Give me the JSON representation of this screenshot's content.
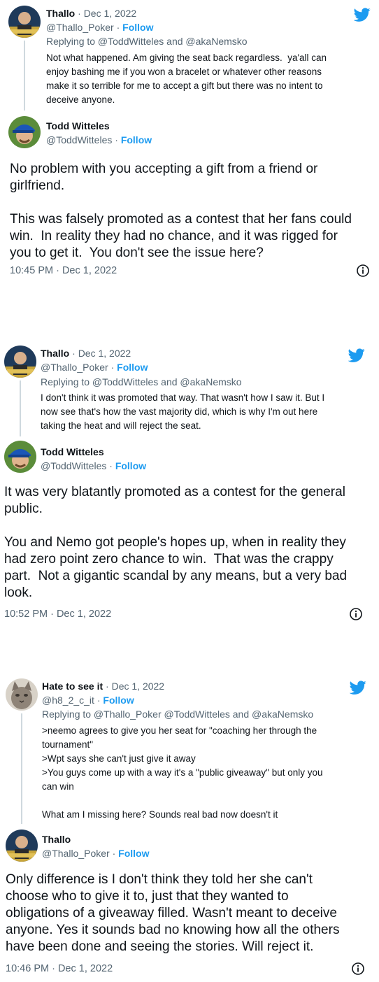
{
  "colors": {
    "accent": "#1d9bf0",
    "secondary_text": "#536471",
    "text": "#0f1419",
    "line": "#cfd9de"
  },
  "icons": {
    "logo": "twitter-bird-icon",
    "info": "info-icon"
  },
  "tweets": [
    {
      "parent": {
        "name": "Thallo",
        "separator": "·",
        "date": "Dec 1, 2022",
        "handle": "@Thallo_Poker",
        "follow": "Follow",
        "replying": "Replying to @ToddWitteles and @akaNemsko",
        "text": "Not what happened. Am giving the seat back regardless.  ya'all can\nenjoy bashing me if you won a bracelet or whatever other reasons\nmake it so terrible for me to accept a gift but there was no intent to\ndeceive anyone."
      },
      "reply": {
        "name": "Todd Witteles",
        "handle": "@ToddWitteles",
        "follow": "Follow",
        "text": "No problem with you accepting a gift from a friend or\ngirlfriend.\n\nThis was falsely promoted as a contest that her fans could\nwin.  In reality they had no chance, and it was rigged for\nyou to get it.  You don't see the issue here?",
        "timestamp": "10:45 PM · Dec 1, 2022"
      }
    },
    {
      "parent": {
        "name": "Thallo",
        "separator": "·",
        "date": "Dec 1, 2022",
        "handle": "@Thallo_Poker",
        "follow": "Follow",
        "replying": "Replying to @ToddWitteles and @akaNemsko",
        "text": "I don't think it was promoted that way. That wasn't how I saw it. But I\nnow see that's how the vast majority did, which is why I'm out here\ntaking the heat and will reject the seat."
      },
      "reply": {
        "name": "Todd Witteles",
        "handle": "@ToddWitteles",
        "follow": "Follow",
        "text": "It was very blatantly promoted as a contest for the general\npublic.\n\nYou and Nemo got people's hopes up, when in reality they\nhad zero point zero chance to win.  That was the crappy\npart.  Not a gigantic scandal by any means, but a very bad\nlook.",
        "timestamp": "10:52 PM · Dec 1, 2022"
      }
    },
    {
      "parent": {
        "name": "Hate to see it",
        "separator": "·",
        "date": "Dec 1, 2022",
        "handle": "@h8_2_c_it",
        "follow": "Follow",
        "replying": "Replying to @Thallo_Poker @ToddWitteles and @akaNemsko",
        "text": ">neemo agrees to give you her seat for \"coaching her through the\ntournament\"\n>Wpt says she can't just give it away\n>You guys come up with a way it's a \"public giveaway\" but only you\ncan win\n\nWhat am I missing here? Sounds real bad now doesn't it"
      },
      "reply": {
        "name": "Thallo",
        "handle": "@Thallo_Poker",
        "follow": "Follow",
        "text": "Only difference is I don't think they told her she can't\nchoose who to give it to, just that they wanted to\nobligations of a giveaway filled. Wasn't meant to deceive\nanyone. Yes it sounds bad no knowing how all the others\nhave been done and seeing the stories. Will reject it.",
        "timestamp": "10:46 PM · Dec 1, 2022"
      }
    }
  ]
}
